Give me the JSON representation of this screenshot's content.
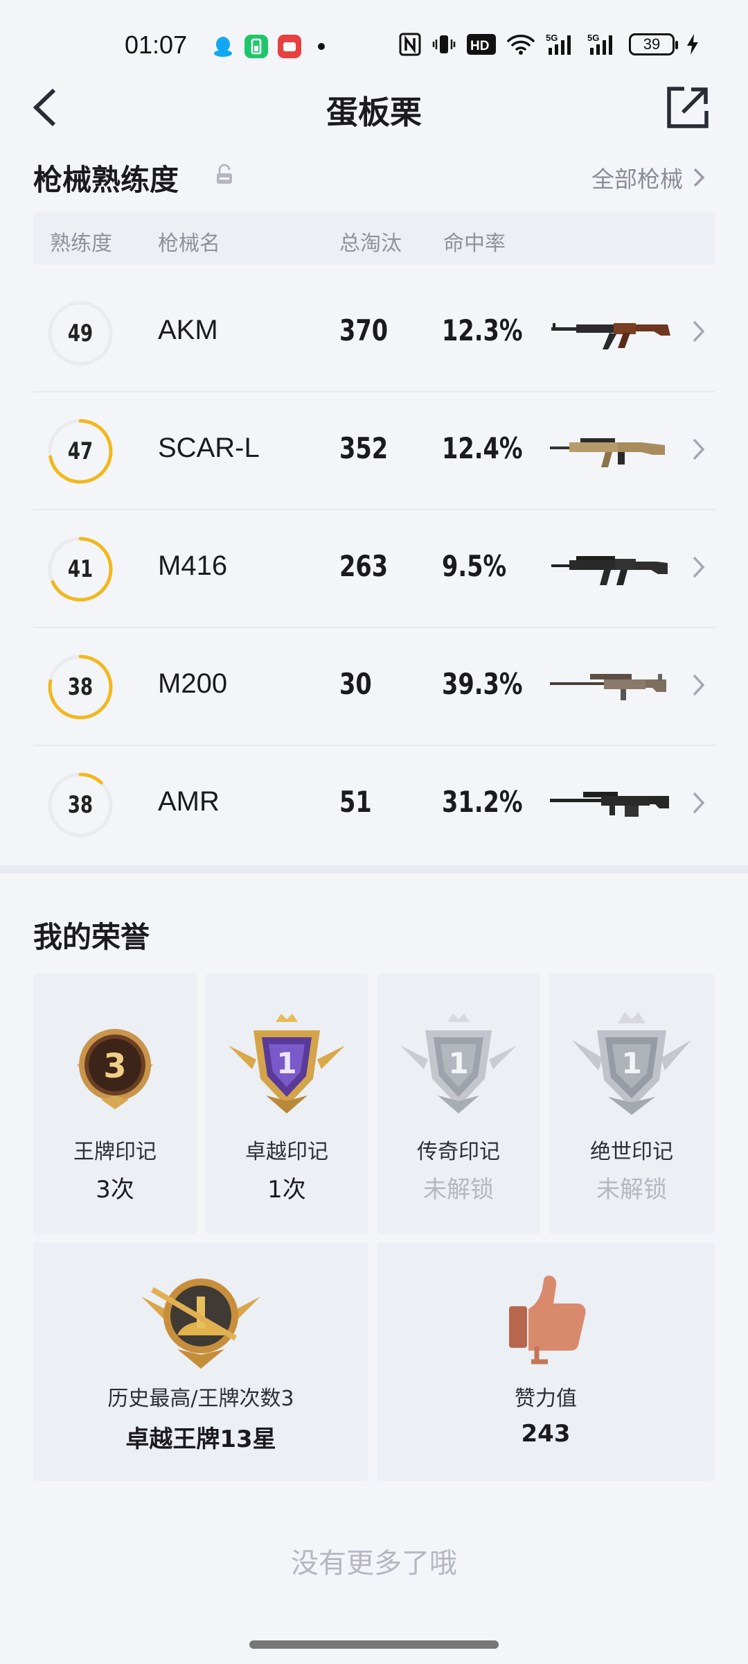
{
  "status_bar": {
    "time": "01:07",
    "battery": "39",
    "network_1": "5G",
    "network_2": "5G",
    "hd_label": "HD",
    "nfc_label": "N"
  },
  "header": {
    "title": "蛋板栗",
    "back_icon": "chevron-left-icon",
    "share_icon": "share-external-icon"
  },
  "weapons": {
    "section_title": "枪械熟练度",
    "all_link": "全部枪械",
    "columns": [
      "熟练度",
      "枪械名",
      "总淘汰",
      "命中率"
    ],
    "ring_color": "#f2b81c",
    "ring_track_color": "#e9ebef",
    "rows": [
      {
        "level": "49",
        "progress": 0.0,
        "name": "AKM",
        "kills": "370",
        "accuracy": "12.3%",
        "gun_icon": "akm-rifle-icon"
      },
      {
        "level": "47",
        "progress": 0.72,
        "name": "SCAR-L",
        "kills": "352",
        "accuracy": "12.4%",
        "gun_icon": "scar-rifle-icon"
      },
      {
        "level": "41",
        "progress": 0.68,
        "name": "M416",
        "kills": "263",
        "accuracy": "9.5%",
        "gun_icon": "m416-rifle-icon"
      },
      {
        "level": "38",
        "progress": 0.78,
        "name": "M200",
        "kills": "30",
        "accuracy": "39.3%",
        "gun_icon": "m200-sniper-icon"
      },
      {
        "level": "38",
        "progress": 0.12,
        "name": "AMR",
        "kills": "51",
        "accuracy": "31.2%",
        "gun_icon": "amr-sniper-icon"
      }
    ]
  },
  "honors": {
    "section_title": "我的荣誉",
    "marks": [
      {
        "label": "王牌印记",
        "value": "3次",
        "locked": false,
        "badge_number": "3"
      },
      {
        "label": "卓越印记",
        "value": "1次",
        "locked": false,
        "badge_number": "1"
      },
      {
        "label": "传奇印记",
        "value": "未解锁",
        "locked": true,
        "badge_number": "1"
      },
      {
        "label": "绝世印记",
        "value": "未解锁",
        "locked": true,
        "badge_number": "1"
      }
    ],
    "best_rank": {
      "label": "历史最高/王牌次数3",
      "value": "卓越王牌13星"
    },
    "likes": {
      "label": "赞力值",
      "value": "243"
    }
  },
  "footer": {
    "no_more": "没有更多了哦"
  }
}
